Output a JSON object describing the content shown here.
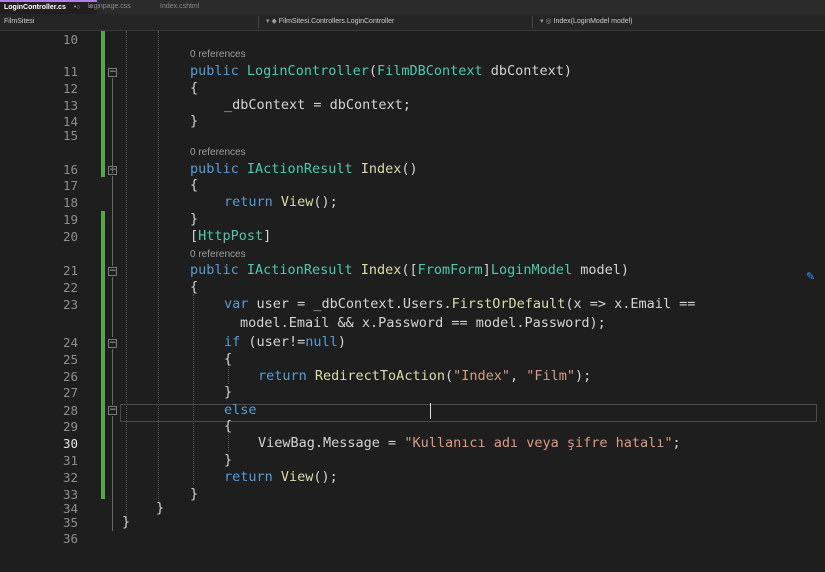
{
  "tabs": [
    {
      "label": "LoginController.cs",
      "active": true
    },
    {
      "label": "loginpage.css",
      "active": false
    },
    {
      "label": "Index.cshtml",
      "active": false
    }
  ],
  "tab_icons": {
    "pin": "•○",
    "close": "×"
  },
  "navbar": {
    "project": "FilmSitesi",
    "namespace": "FilmSitesi.Controllers.LoginController",
    "member": "Index(LoginModel model)"
  },
  "code_lens": {
    "references": "0 references"
  },
  "line_numbers": [
    "10",
    "11",
    "12",
    "13",
    "14",
    "15",
    "16",
    "17",
    "18",
    "19",
    "20",
    "21",
    "22",
    "23",
    "24",
    "25",
    "26",
    "27",
    "28",
    "29",
    "30",
    "31",
    "32",
    "33",
    "34",
    "35",
    "36"
  ],
  "current_line": "30",
  "code": {
    "l11": {
      "kw1": "public",
      "ctor": "LoginController",
      "open": "(",
      "type": "FilmDBContext",
      "rest": " dbContext)"
    },
    "l12": "{",
    "l13": "_dbContext = dbContext;",
    "l14": "}",
    "l16": {
      "kw1": "public",
      "type": "IActionResult",
      "name": " Index",
      "rest": "()"
    },
    "l17": "{",
    "l18": {
      "kw": "return",
      "name": " View",
      "rest": "();"
    },
    "l19": "}",
    "l20": {
      "open": "[",
      "attr": "HttpPost",
      "close": "]"
    },
    "l21": {
      "kw1": "public",
      "type": "IActionResult",
      "name": " Index",
      "p1": "([",
      "attr": "FromForm",
      "p2": "]",
      "type2": "LoginModel",
      "rest": " model)"
    },
    "l22": "{",
    "l23a": {
      "kw": "var",
      "rest1": " user = _dbContext.Users.",
      "fn": "FirstOrDefault",
      "rest2": "(x => x.Email =="
    },
    "l23b": "model.Email && x.Password == model.Password);",
    "l24": {
      "kw": "if",
      "p1": " (user!=",
      "kw2": "null",
      "p2": ")"
    },
    "l25": "{",
    "l26": {
      "kw": "return",
      "fn": " RedirectToAction",
      "p1": "(",
      "s1": "\"Index\"",
      "p2": ", ",
      "s2": "\"Film\"",
      "p3": ");"
    },
    "l27": "}",
    "l28": "else",
    "l29": "{",
    "l30": {
      "pre": "ViewBag.Message = ",
      "str": "\"Kullanıcı adı veya şifre hatalı\"",
      "end": ";"
    },
    "l31": "}",
    "l32": {
      "kw": "return",
      "fn": " View",
      "rest": "();"
    },
    "l33": "}",
    "l34": "}",
    "l35": "}"
  },
  "colors": {
    "keyword": "#569cd6",
    "type": "#4ec9b0",
    "method": "#dcdcaa",
    "string": "#d69d85",
    "change_bar": "#57a64a"
  },
  "icons": [
    "lightbulb-icon",
    "fold-icon",
    "pin-icon",
    "close-icon"
  ]
}
